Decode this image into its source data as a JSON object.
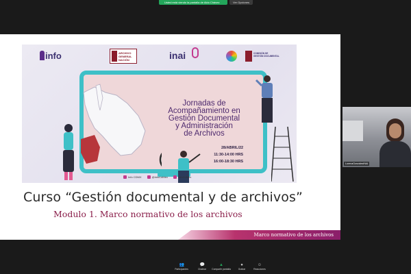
{
  "share_banner": {
    "status_text": "Usted está viendo la pantalla de Aldo Chávez",
    "options_label": "Ver Opciones"
  },
  "slide": {
    "logos": {
      "info": "info",
      "agn": [
        "ARCHIVO",
        "GENERAL",
        "NACIÓN"
      ],
      "inai": "inai",
      "cgd": [
        "COMISIÓN DE",
        "GESTIÓN DOCUMENTAL"
      ]
    },
    "headline": [
      "Jornadas de",
      "Acompañamiento en",
      "Gestión Documental",
      "y Administración",
      "de Archivos"
    ],
    "date": "28/ABRIL/22",
    "schedule": [
      "11:30-14:00 HRS",
      "16:00-18:30 HRS"
    ],
    "socials": [
      "Info CDMX",
      "@InfoCdMex",
      "InfoCdMex"
    ],
    "course_title": "Curso “Gestión documental y de archivos”",
    "module_title": "Modulo 1. Marco normativo de los archivos",
    "footer_text": "Marco normativo de los archivos"
  },
  "participant": {
    "name": "LorenaGonzálezINAI"
  },
  "toolbar": {
    "items": [
      {
        "label": "Participantes",
        "icon": "participants-icon",
        "glyph": "👥"
      },
      {
        "label": "Chatear",
        "icon": "chat-icon",
        "glyph": "💬"
      },
      {
        "label": "Compartir pantalla",
        "icon": "share-screen-icon",
        "glyph": "▲"
      },
      {
        "label": "Grabar",
        "icon": "record-icon",
        "glyph": "●"
      },
      {
        "label": "Reacciones",
        "icon": "reactions-icon",
        "glyph": "☺"
      }
    ]
  },
  "colors": {
    "share_green": "#23a55a",
    "banner_teal": "#3ec0c7",
    "brand_purple": "#4e2a6e",
    "brand_magenta": "#8a1e4a"
  }
}
